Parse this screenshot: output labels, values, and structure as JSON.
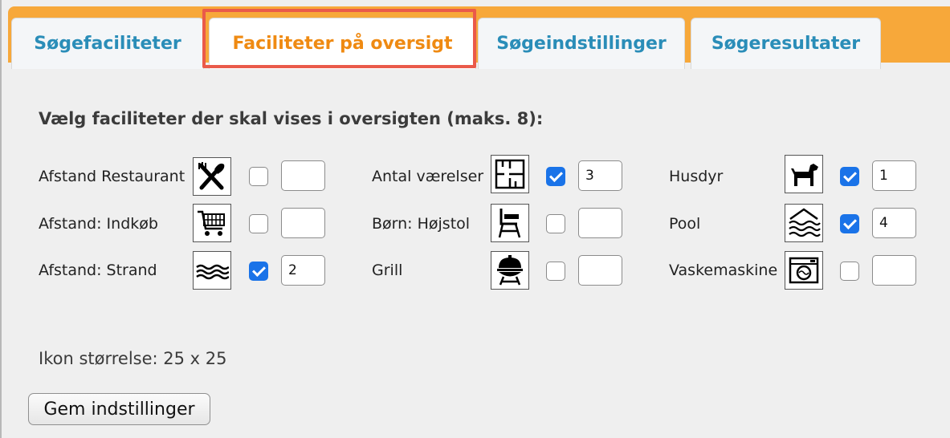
{
  "tabs": [
    {
      "label": "Søgefaciliteter",
      "active": false
    },
    {
      "label": "Faciliteter på oversigt",
      "active": true
    },
    {
      "label": "Søgeindstillinger",
      "active": false
    },
    {
      "label": "Søgeresultater",
      "active": false
    }
  ],
  "heading": "Vælg faciliteter der skal vises i oversigten (maks. 8):",
  "facilities": [
    {
      "label": "Afstand Restaurant",
      "icon": "restaurant-icon",
      "checked": false,
      "value": ""
    },
    {
      "label": "Afstand: Indkøb",
      "icon": "shopping-cart-icon",
      "checked": false,
      "value": ""
    },
    {
      "label": "Afstand: Strand",
      "icon": "beach-icon",
      "checked": true,
      "value": "2"
    },
    {
      "label": "Antal værelser",
      "icon": "floorplan-icon",
      "checked": true,
      "value": "3"
    },
    {
      "label": "Børn: Højstol",
      "icon": "high-chair-icon",
      "checked": false,
      "value": ""
    },
    {
      "label": "Grill",
      "icon": "grill-icon",
      "checked": false,
      "value": ""
    },
    {
      "label": "Husdyr",
      "icon": "dog-icon",
      "checked": true,
      "value": "1"
    },
    {
      "label": "Pool",
      "icon": "pool-icon",
      "checked": true,
      "value": "4"
    },
    {
      "label": "Vaskemaskine",
      "icon": "washing-machine-icon",
      "checked": false,
      "value": ""
    }
  ],
  "icon_size_text": "Ikon størrelse: 25 x 25",
  "save_button": "Gem indstillinger"
}
